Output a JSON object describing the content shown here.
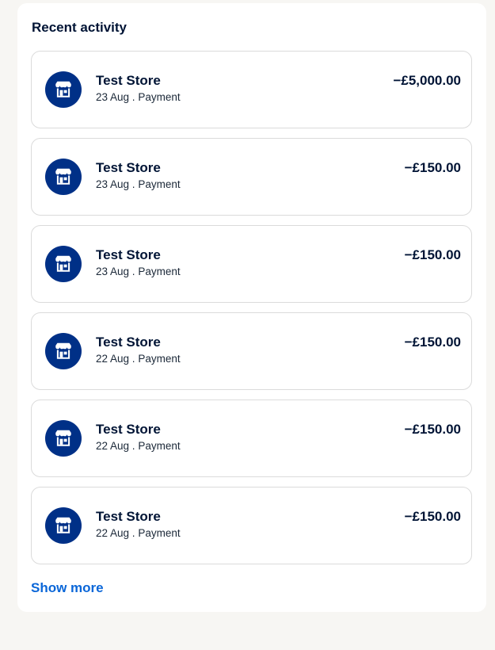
{
  "recent_activity": {
    "title": "Recent activity",
    "show_more_label": "Show more",
    "items": [
      {
        "merchant": "Test Store",
        "date": "23 Aug",
        "separator": " . ",
        "type": "Payment",
        "amount": "−£5,000.00",
        "icon": "store-icon"
      },
      {
        "merchant": "Test Store",
        "date": "23 Aug",
        "separator": " . ",
        "type": "Payment",
        "amount": "−£150.00",
        "icon": "store-icon"
      },
      {
        "merchant": "Test Store",
        "date": "23 Aug",
        "separator": " . ",
        "type": "Payment",
        "amount": "−£150.00",
        "icon": "store-icon"
      },
      {
        "merchant": "Test Store",
        "date": "22 Aug",
        "separator": " . ",
        "type": "Payment",
        "amount": "−£150.00",
        "icon": "store-icon"
      },
      {
        "merchant": "Test Store",
        "date": "22 Aug",
        "separator": " . ",
        "type": "Payment",
        "amount": "−£150.00",
        "icon": "store-icon"
      },
      {
        "merchant": "Test Store",
        "date": "22 Aug",
        "separator": " . ",
        "type": "Payment",
        "amount": "−£150.00",
        "icon": "store-icon"
      }
    ]
  },
  "colors": {
    "page_background": "#f7f6f3",
    "panel_background": "#ffffff",
    "icon_background": "#003087",
    "text_primary": "#001435",
    "link": "#0a66d8",
    "border": "#dbdbdb"
  }
}
